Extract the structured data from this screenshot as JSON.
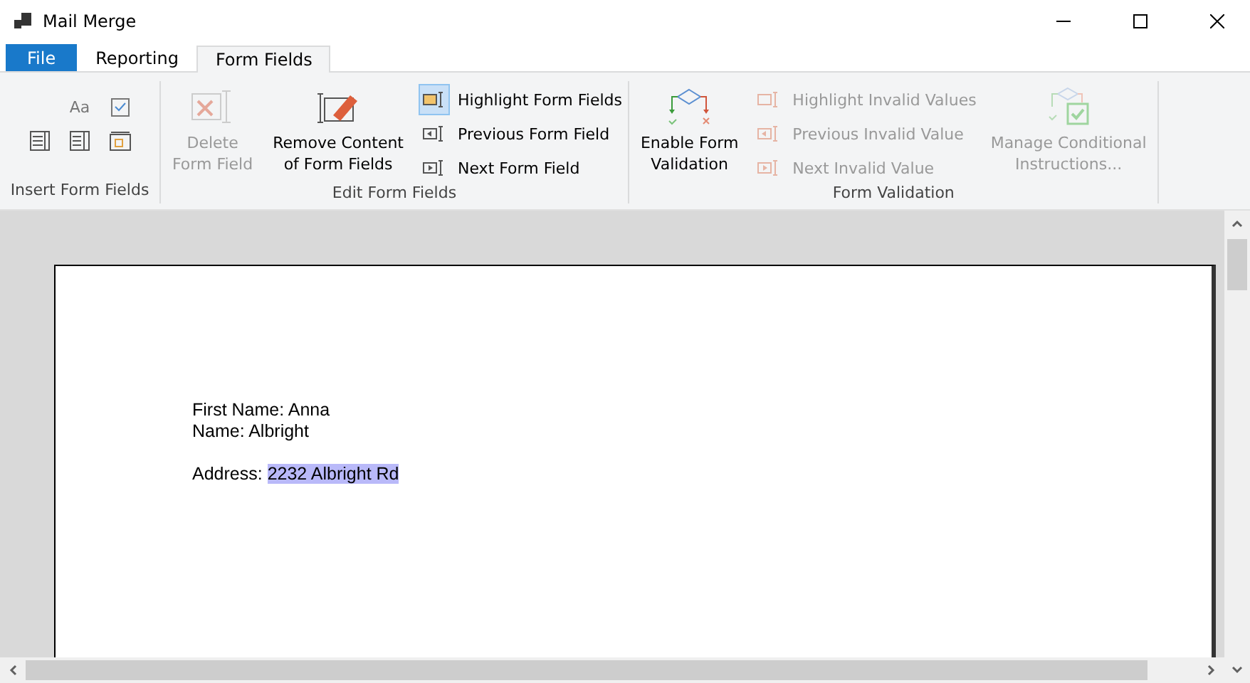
{
  "window": {
    "title": "Mail Merge"
  },
  "tabs": [
    {
      "label": "File",
      "kind": "file",
      "selected": false
    },
    {
      "label": "Reporting",
      "kind": "tab",
      "selected": false
    },
    {
      "label": "Form Fields",
      "kind": "tab",
      "selected": true
    }
  ],
  "ribbon": [
    {
      "label": "Insert Form Fields",
      "items": [
        {
          "kind": "icons",
          "glyph": "Aa"
        }
      ]
    },
    {
      "label": "Edit Form Fields",
      "items": [
        {
          "kind": "large",
          "lines": [
            "Delete",
            "Form Field"
          ],
          "disabled": true
        },
        {
          "kind": "large",
          "lines": [
            "Remove Content",
            "of Form Fields"
          ],
          "disabled": false
        },
        {
          "kind": "stack",
          "rows": [
            {
              "label": "Highlight Form Fields",
              "disabled": false,
              "selected": true
            },
            {
              "label": "Previous Form Field",
              "disabled": false,
              "selected": false
            },
            {
              "label": "Next Form Field",
              "disabled": false,
              "selected": false
            }
          ]
        }
      ]
    },
    {
      "label": "Form Validation",
      "items": [
        {
          "kind": "large",
          "lines": [
            "Enable Form",
            "Validation"
          ],
          "disabled": false
        },
        {
          "kind": "stack",
          "rows": [
            {
              "label": "Highlight Invalid Values",
              "disabled": true,
              "selected": false
            },
            {
              "label": "Previous Invalid Value",
              "disabled": true,
              "selected": false
            },
            {
              "label": "Next Invalid Value",
              "disabled": true,
              "selected": false
            }
          ]
        },
        {
          "kind": "large",
          "lines": [
            "Manage Conditional",
            "Instructions..."
          ],
          "disabled": true
        }
      ]
    }
  ],
  "document": {
    "paragraphs": [
      [
        [
          {
            "text": "First Name: Anna",
            "highlighted": false
          }
        ],
        [
          {
            "text": "Name: Albright",
            "highlighted": false
          }
        ]
      ],
      [
        [
          {
            "text": "Address: ",
            "highlighted": false
          },
          {
            "text": "2232 Albright Rd",
            "highlighted": true
          }
        ]
      ]
    ]
  }
}
